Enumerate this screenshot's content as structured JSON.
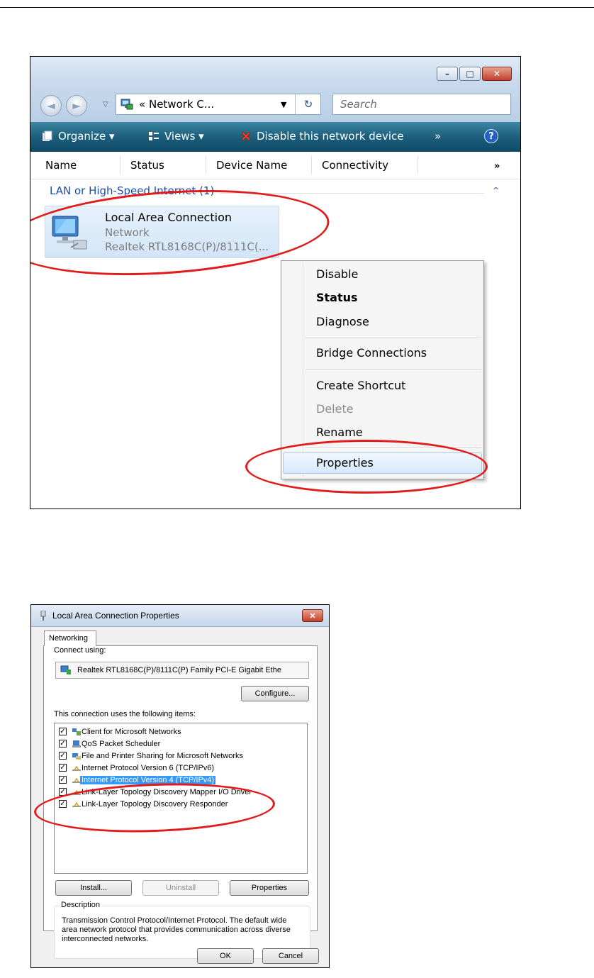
{
  "explorer": {
    "caption_buttons": {
      "minimize": "–",
      "maximize": "□",
      "close": "✕"
    },
    "nav": {
      "back": "◄",
      "forward": "►",
      "dropdown": "▽"
    },
    "address": {
      "prefix": "«",
      "text": "Network C...",
      "dropdown": "▼",
      "refresh": "↻"
    },
    "search": {
      "placeholder": "Search"
    },
    "toolbar": {
      "organize": "Organize ▾",
      "views": "Views ▾",
      "disable": "Disable this network device",
      "more": "»",
      "help": "?"
    },
    "columns": [
      "Name",
      "Status",
      "Device Name",
      "Connectivity"
    ],
    "columns_more": "»",
    "group": {
      "label": "LAN or High-Speed Internet (1)",
      "chevron": "^"
    },
    "connection": {
      "name": "Local Area Connection",
      "status": "Network",
      "device": "Realtek RTL8168C(P)/8111C(..."
    },
    "context_menu": [
      {
        "label": "Disable",
        "style": "normal"
      },
      {
        "label": "Status",
        "style": "bold"
      },
      {
        "label": "Diagnose",
        "style": "normal"
      },
      {
        "label": "Bridge Connections",
        "style": "normal"
      },
      {
        "label": "Create Shortcut",
        "style": "normal"
      },
      {
        "label": "Delete",
        "style": "disabled"
      },
      {
        "label": "Rename",
        "style": "normal"
      },
      {
        "label": "Properties",
        "style": "highlighted"
      }
    ]
  },
  "dialog": {
    "title": "Local Area Connection Properties",
    "close": "✕",
    "tab": "Networking",
    "connect_using_label": "Connect using:",
    "adapter": "Realtek RTL8168C(P)/8111C(P) Family PCI-E Gigabit Ethe",
    "configure_button": "Configure...",
    "items_label": "This connection uses the following items:",
    "items": [
      {
        "label": "Client for Microsoft Networks",
        "checked": true,
        "selected": false,
        "icon": "client-icon"
      },
      {
        "label": "QoS Packet Scheduler",
        "checked": true,
        "selected": false,
        "icon": "scheduler-icon"
      },
      {
        "label": "File and Printer Sharing for Microsoft Networks",
        "checked": true,
        "selected": false,
        "icon": "sharing-icon"
      },
      {
        "label": "Internet Protocol Version 6 (TCP/IPv6)",
        "checked": true,
        "selected": false,
        "icon": "protocol-icon"
      },
      {
        "label": "Internet Protocol Version 4 (TCP/IPv4)",
        "checked": true,
        "selected": true,
        "icon": "protocol-icon"
      },
      {
        "label": "Link-Layer Topology Discovery Mapper I/O Driver",
        "checked": true,
        "selected": false,
        "icon": "protocol-icon"
      },
      {
        "label": "Link-Layer Topology Discovery Responder",
        "checked": true,
        "selected": false,
        "icon": "protocol-icon"
      }
    ],
    "buttons": {
      "install": "Install...",
      "uninstall": "Uninstall",
      "properties": "Properties",
      "ok": "OK",
      "cancel": "Cancel"
    },
    "description_title": "Description",
    "description": "Transmission Control Protocol/Internet Protocol. The default wide area network protocol that provides communication across diverse interconnected networks."
  },
  "colors": {
    "annotation_red": "#e11a1a",
    "selection_blue": "#3399ff",
    "toolbar_teal": "#1c5f7d"
  }
}
